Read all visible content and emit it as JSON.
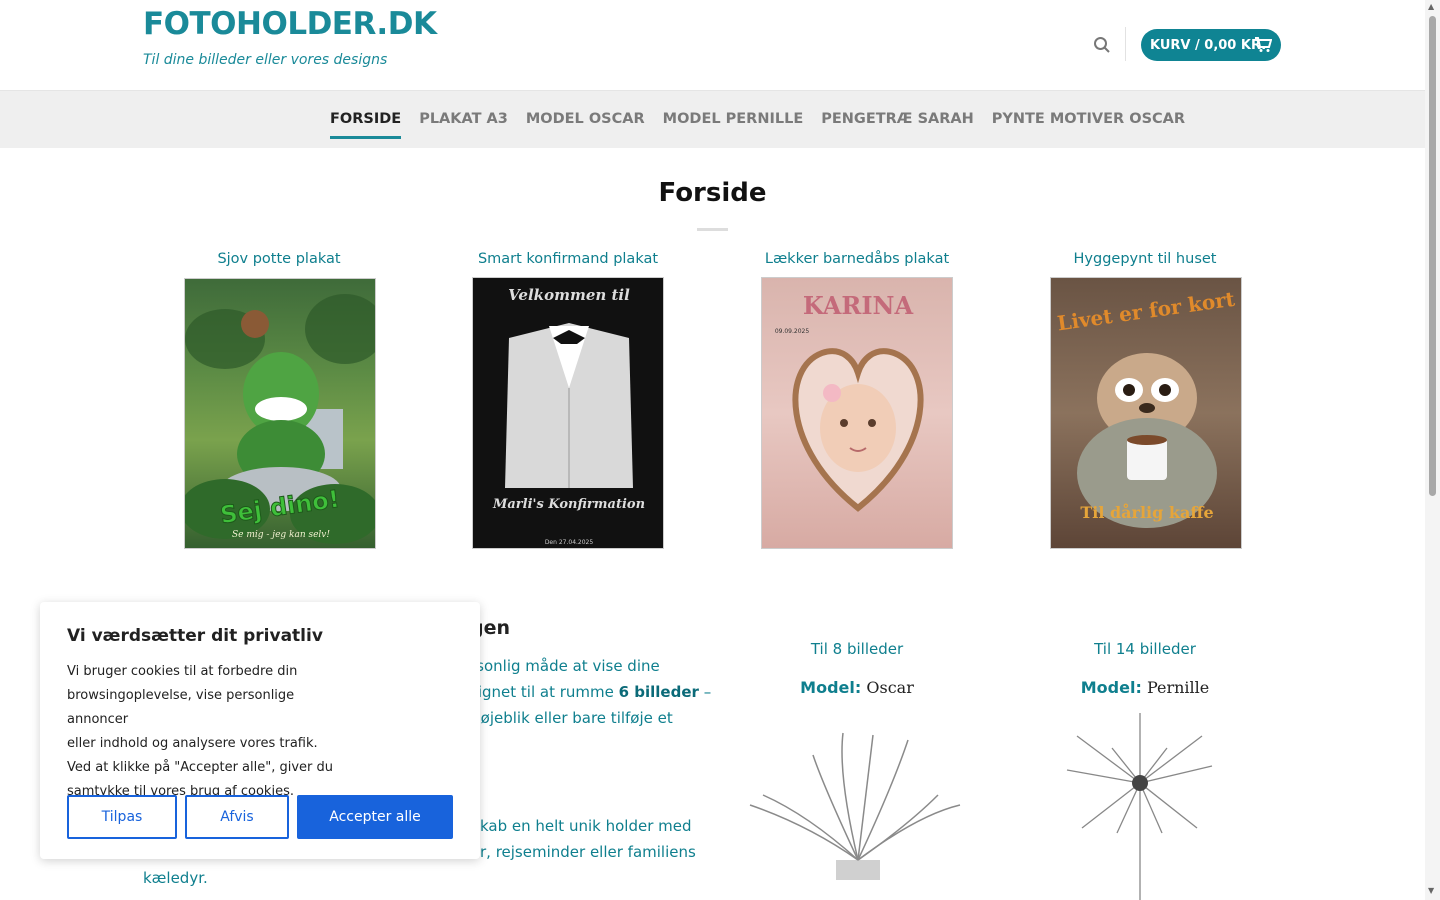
{
  "header": {
    "logo": "FOTOHOLDER.DK",
    "tagline": "Til dine billeder eller vores designs",
    "cart_label": "KURV / 0,00 KR."
  },
  "nav": {
    "items": [
      {
        "label": "FORSIDE",
        "active": true
      },
      {
        "label": "PLAKAT A3",
        "active": false
      },
      {
        "label": "MODEL OSCAR",
        "active": false
      },
      {
        "label": "MODEL PERNILLE",
        "active": false
      },
      {
        "label": "PENGETRÆ SARAH",
        "active": false
      },
      {
        "label": "PYNTE MOTIVER OSCAR",
        "active": false
      }
    ]
  },
  "page": {
    "title": "Forside"
  },
  "posters": [
    {
      "title": "Sjov potte plakat",
      "caption": "Sej dino!",
      "subcaption": "Se mig - jeg kan selv!"
    },
    {
      "title": "Smart konfirmand plakat",
      "caption_top": "Velkommen til",
      "caption": "Marli's Konfirmation",
      "subcaption": "Den 27.04.2025"
    },
    {
      "title": "Lækker barnedåbs plakat",
      "caption_top": "KARINA",
      "subcaption": "09.09.2025"
    },
    {
      "title": "Hyggepynt til huset",
      "caption_top": "Livet er for kort",
      "caption": "Til dårlig kaffe"
    }
  ],
  "intro": {
    "heading_fragment": "gen",
    "para1_line1": "rsonlig måde at vise dine",
    "para1_line2_a": "signet til at rumme ",
    "para1_line2_b": "6 billeder",
    "para1_line2_c": " –",
    "para1_line3": "t øjeblik eller bare tilføje et",
    "para2_line1": "kab en helt unik holder med",
    "para2_line2": "r, rejseminder eller familiens",
    "para2_line3": "kæledyr."
  },
  "models": [
    {
      "subtitle": "Til 8 billeder",
      "label": "Model:",
      "name": "Oscar"
    },
    {
      "subtitle": "Til 14 billeder",
      "label": "Model:",
      "name": "Pernille"
    }
  ],
  "cookie": {
    "title": "Vi værdsætter dit privatliv",
    "text_line1": "Vi bruger cookies til at forbedre din",
    "text_line2": "browsingoplevelse, vise personlige annoncer",
    "text_line3": "eller indhold og analysere vores trafik.",
    "text_line4": "Ved at klikke på \"Accepter alle\", giver du",
    "text_line5": "samtykke til vores brug af cookies.",
    "customize_label": "Tilpas",
    "reject_label": "Afvis",
    "accept_label": "Accepter alle"
  },
  "colors": {
    "brand": "#1a8a99",
    "cart": "#0f8493",
    "cookie_button": "#1863dc"
  }
}
